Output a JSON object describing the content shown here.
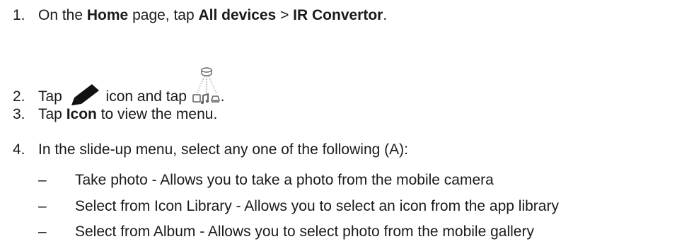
{
  "steps": {
    "s1": {
      "num": "1.",
      "t1": "On the ",
      "b1": "Home",
      "t2": " page, tap ",
      "b2": "All devices",
      "t3": " > ",
      "b3": "IR Convertor",
      "t4": "."
    },
    "s2": {
      "num": "2.",
      "t1": "Tap ",
      "t2": " icon and tap ",
      "t3": ".",
      "icon1": "pencil-icon",
      "icon2": "ir-converter-device-icon"
    },
    "s3": {
      "num": "3.",
      "t1": "Tap ",
      "b1": "Icon",
      "t2": " to view the menu."
    },
    "s4": {
      "num": "4.",
      "text": "In the slide-up menu, select any one of the following (A):"
    }
  },
  "bullets": [
    {
      "dash": "–",
      "text": "Take photo - Allows you to take a photo from the mobile camera"
    },
    {
      "dash": "–",
      "text": "Select from Icon Library - Allows you to select an icon from the app library"
    },
    {
      "dash": "–",
      "text": "Select from Album - Allows you to select photo from the mobile gallery"
    }
  ]
}
